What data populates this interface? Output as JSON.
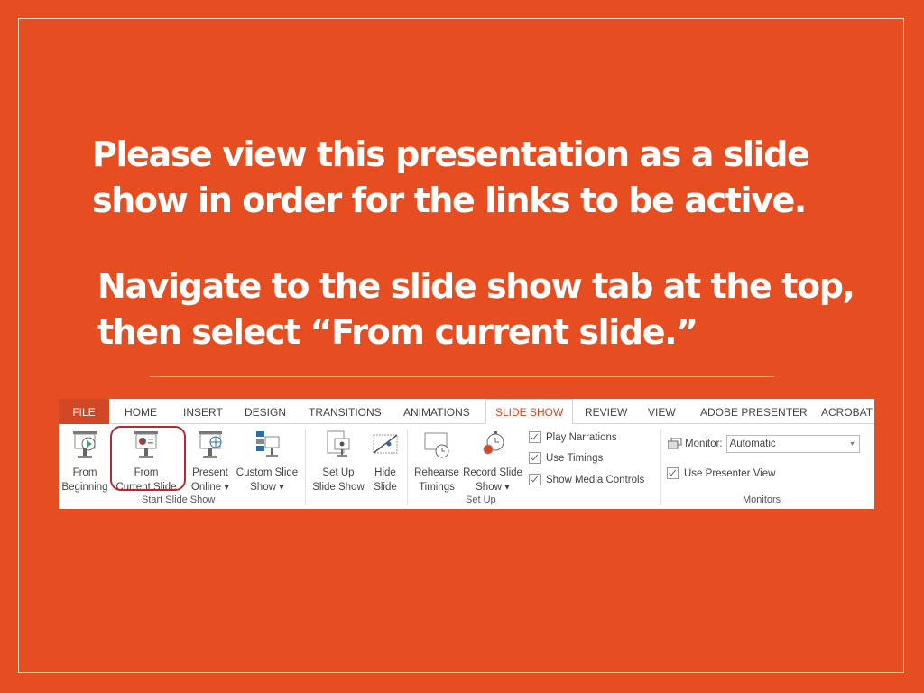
{
  "slide": {
    "title": "Please view this presentation as a slide show in order for the links to be active.",
    "subtitle": "Navigate to the slide show tab at the top, then select “From current slide.”",
    "background_color": "#e64e21"
  },
  "ribbon": {
    "tabs": [
      "FILE",
      "HOME",
      "INSERT",
      "DESIGN",
      "TRANSITIONS",
      "ANIMATIONS",
      "SLIDE SHOW",
      "REVIEW",
      "VIEW",
      "ADOBE PRESENTER",
      "ACROBAT"
    ],
    "active_tab": "SLIDE SHOW",
    "groups": {
      "start": {
        "label": "Start Slide Show",
        "from_beginning": [
          "From",
          "Beginning"
        ],
        "from_current": [
          "From",
          "Current Slide"
        ],
        "present_online": [
          "Present",
          "Online ▾"
        ],
        "custom_show": [
          "Custom Slide",
          "Show ▾"
        ]
      },
      "setup": {
        "label": "Set Up",
        "setup_show": [
          "Set Up",
          "Slide Show"
        ],
        "hide_slide": [
          "Hide",
          "Slide"
        ],
        "rehearse": [
          "Rehearse",
          "Timings"
        ],
        "record": [
          "Record Slide",
          "Show ▾"
        ],
        "checkboxes": [
          "Play Narrations",
          "Use Timings",
          "Show Media Controls"
        ]
      },
      "monitors": {
        "label": "Monitors",
        "monitor_label": "Monitor:",
        "monitor_value": "Automatic",
        "presenter_view": "Use Presenter View"
      }
    },
    "highlight_color": "#b52a32"
  }
}
